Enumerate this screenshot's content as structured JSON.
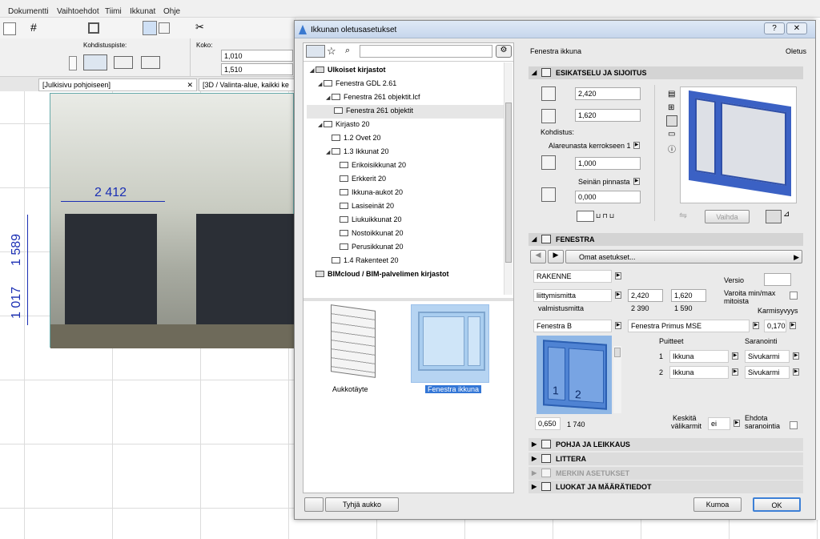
{
  "menu": [
    "Dokumentti",
    "Vaihtoehdot",
    "Tiimi",
    "Ikkunat",
    "Ohje"
  ],
  "infobox": {
    "anchor_label": "Kohdistuspiste:",
    "size_label": "Koko:",
    "width": "1,010",
    "height": "1,510"
  },
  "tabs": [
    "[Julkisivu pohjoiseen]",
    "[3D / Valinta-alue, kaikki ke"
  ],
  "canvas": {
    "dim_horizontal": "2 412",
    "dim_v1": "1 589",
    "dim_v2": "1 017"
  },
  "dialog": {
    "title": "Ikkunan oletusasetukset",
    "help": "?",
    "search": {
      "placeholder": ""
    },
    "tree": [
      {
        "label": "Ulkoiset kirjastot",
        "bold": true
      },
      {
        "label": "Fenestra GDL 2.61"
      },
      {
        "label": "Fenestra 261 objektit.lcf"
      },
      {
        "label": "Fenestra 261 objektit"
      },
      {
        "label": "Kirjasto 20"
      },
      {
        "label": "1.2 Ovet 20"
      },
      {
        "label": "1.3 Ikkunat 20"
      },
      {
        "label": "Erikoisikkunat 20"
      },
      {
        "label": "Erkkerit 20"
      },
      {
        "label": "Ikkuna-aukot 20"
      },
      {
        "label": "Lasiseinät 20"
      },
      {
        "label": "Liukuikkunat 20"
      },
      {
        "label": "Nostoikkunat 20"
      },
      {
        "label": "Perusikkunat 20"
      },
      {
        "label": "1.4 Rakenteet 20"
      },
      {
        "label": "BIMcloud / BIM-palvelimen kirjastot",
        "bold": true
      }
    ],
    "objects": [
      {
        "label": "Aukkotäyte"
      },
      {
        "label": "Fenestra ikkuna"
      }
    ],
    "empty_opening_button": "Tyhjä aukko",
    "header_name": "Fenestra ikkuna",
    "header_default": "Oletus",
    "sect_preview": "ESIKATSELU JA SIJOITUS",
    "width_val": "2,420",
    "height_val": "1,620",
    "anchor_label": "Kohdistus:",
    "anchor_value": "Alareunasta kerrokseen 1",
    "anchor_offset": "1,000",
    "wall_surface_label": "Seinän pinnasta",
    "wall_offset": "0,000",
    "swap_button": "Vaihda",
    "sect_fenestra": "FENESTRA",
    "preset": "Omat asetukset...",
    "rakenne": "RAKENNE",
    "versio_label": "Versio",
    "liittymismitta_label": "liittymismitta",
    "liittymis_w": "2,420",
    "liittymis_h": "1,620",
    "valmistusmitta_label": "valmistusmitta",
    "valmistus_w": "2 390",
    "valmistus_h": "1 590",
    "warn_label_1": "Varoita min/max",
    "warn_label_2": "mitoista",
    "karmisyvyys_label": "Karmisyvyys",
    "type_a": "Fenestra B",
    "type_b": "Fenestra Primus MSE",
    "karmisyvyys_val": "0,170",
    "puitteet_label": "Puitteet",
    "saranointi_label": "Saranointi",
    "rows": [
      {
        "n": "1",
        "p": "Ikkuna",
        "s": "Sivukarmi"
      },
      {
        "n": "2",
        "p": "Ikkuna",
        "s": "Sivukarmi"
      }
    ],
    "preview_n1": "1",
    "preview_n2": "2",
    "bottom_left_val": "0,650",
    "bottom_right_val": "1 740",
    "keskita_1": "Keskitä",
    "keskita_2": "välikarmit",
    "keskita_val": "ei",
    "ehdota_1": "Ehdota",
    "ehdota_2": "saranointia",
    "sect_pohja": "POHJA JA LEIKKAUS",
    "sect_littera": "LITTERA",
    "sect_merkin": "MERKIN ASETUKSET",
    "sect_luokat": "LUOKAT JA MÄÄRÄTIEDOT",
    "cancel": "Kumoa",
    "ok": "OK"
  },
  "colors": {
    "accent": "#2f63d8",
    "window_blue": "#3b61c4",
    "dim_blue": "#1b2fb4"
  }
}
